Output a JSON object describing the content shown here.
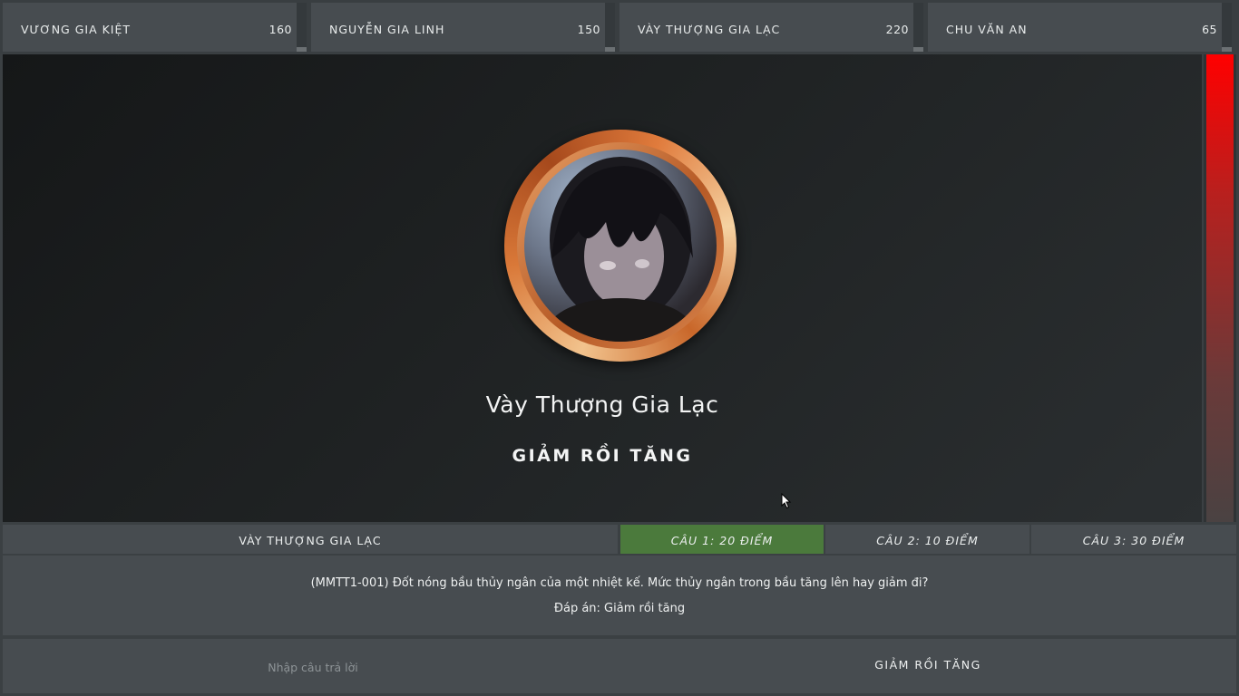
{
  "players": [
    {
      "name": "VƯƠNG GIA KIỆT",
      "score": "160",
      "level": 0.1
    },
    {
      "name": "NGUYỄN GIA LINH",
      "score": "150",
      "level": 0.1
    },
    {
      "name": "VÀY THƯỢNG GIA LẠC",
      "score": "220",
      "level": 0.1
    },
    {
      "name": "CHU VĂN AN",
      "score": "65",
      "level": 0.1
    }
  ],
  "stage": {
    "player_name": "Vày Thượng Gia Lạc",
    "answer": "GIẢM RỒI TĂNG",
    "timer_level": 1.0,
    "avatar_icon": "player-avatar-photo"
  },
  "question_bar": {
    "current_player": "VÀY THƯỢNG GIA LẠC",
    "questions": [
      {
        "label": "CÂU 1: 20 ĐIỂM",
        "active": true
      },
      {
        "label": "CÂU 2: 10 ĐIỂM",
        "active": false
      },
      {
        "label": "CÂU 3: 30 ĐIỂM",
        "active": false
      }
    ]
  },
  "question": {
    "text": "(MMTT1-001) Đốt nóng bầu thủy ngân của một nhiệt kế. Mức thủy ngân trong bầu tăng lên hay giảm đi?",
    "answer": "Đáp án: Giảm rồi tăng"
  },
  "input": {
    "placeholder": "Nhập câu trả lời",
    "value": "",
    "submitted_answer": "GIẢM RỒI TĂNG"
  },
  "colors": {
    "active_question": "#4b7a3c",
    "timer_top": "#ff0000",
    "panel": "#474c50"
  }
}
